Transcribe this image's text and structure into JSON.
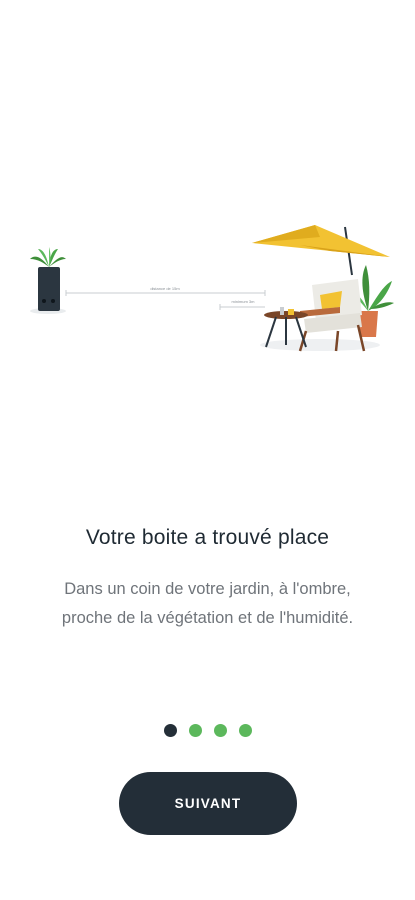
{
  "onboarding": {
    "illustration": {
      "label_long": "distance de 15m",
      "label_short": "minimum 3m"
    },
    "title": "Votre boite a trouvé place",
    "description_line1": "Dans un coin de votre jardin, à l'ombre,",
    "description_line2": "proche de la végétation et de l'humidité.",
    "pagination": {
      "total": 4,
      "current": 1
    },
    "next_button_label": "SUIVANT"
  },
  "colors": {
    "primary_dark": "#232e38",
    "accent_green": "#5cb85c",
    "umbrella_yellow": "#f2c232"
  }
}
